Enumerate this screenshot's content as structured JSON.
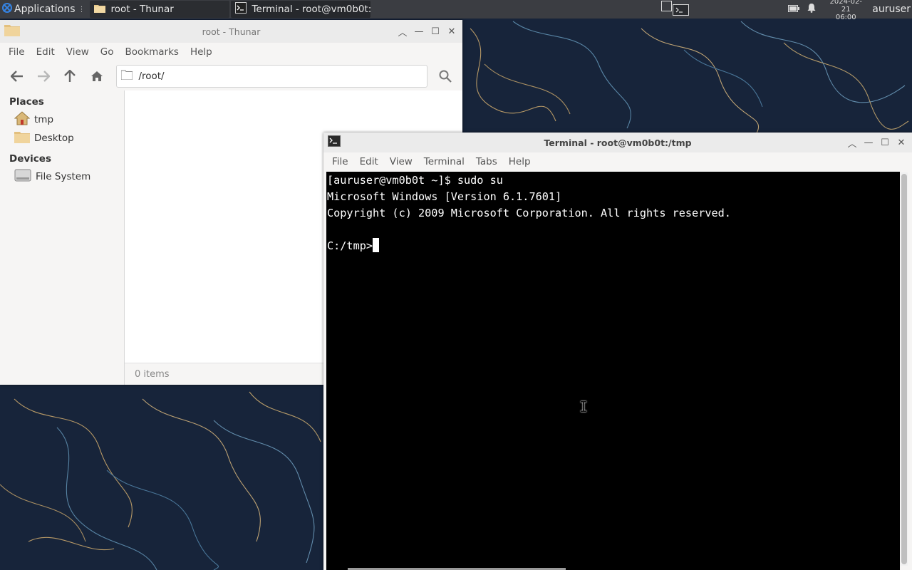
{
  "panel": {
    "apps_label": "Applications",
    "tasks": [
      {
        "label": "root - Thunar"
      },
      {
        "label": "Terminal - root@vm0b0t:/..."
      }
    ],
    "clock_date": "2024-02-21",
    "clock_time": "06:00",
    "user": "auruser"
  },
  "thunar": {
    "title": "root - Thunar",
    "menu": [
      "File",
      "Edit",
      "View",
      "Go",
      "Bookmarks",
      "Help"
    ],
    "location": "/root/",
    "sidebar": {
      "places_header": "Places",
      "places": [
        "tmp",
        "Desktop"
      ],
      "devices_header": "Devices",
      "devices": [
        "File System"
      ]
    },
    "status": "0 items"
  },
  "terminal": {
    "title": "Terminal - root@vm0b0t:/tmp",
    "menu": [
      "File",
      "Edit",
      "View",
      "Terminal",
      "Tabs",
      "Help"
    ],
    "lines": [
      "[auruser@vm0b0t ~]$ sudo su",
      "Microsoft Windows [Version 6.1.7601]",
      "Copyright (c) 2009 Microsoft Corporation. All rights reserved.",
      "",
      "C:/tmp>"
    ]
  },
  "colors": {
    "panel_bg": "#3b3d42",
    "wallpaper_bg": "#17243a",
    "terminal_bg": "#000000",
    "terminal_fg": "#ffffff",
    "accent": "#3584e4"
  }
}
